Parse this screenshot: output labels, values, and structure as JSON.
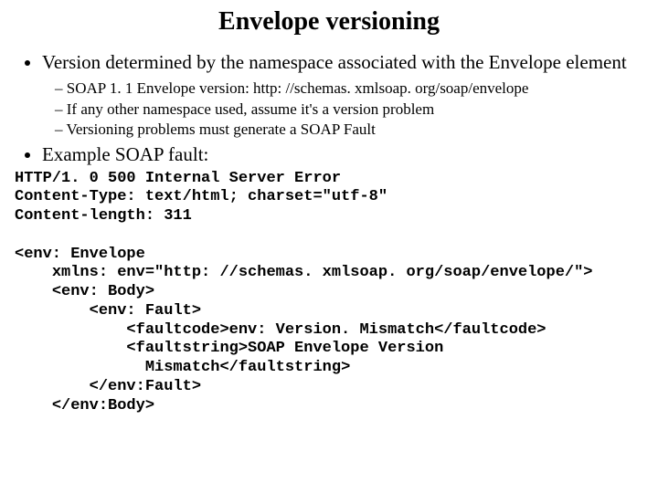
{
  "title": "Envelope versioning",
  "bullet1": "Version determined by the namespace associated with the Envelope element",
  "sub1": "SOAP 1. 1 Envelope  version: http: //schemas. xmlsoap. org/soap/envelope",
  "sub2": "If any other namespace used, assume it's a version problem",
  "sub3": "Versioning problems must generate a SOAP Fault",
  "bullet2": "Example SOAP fault:",
  "code": "HTTP/1. 0 500 Internal Server Error\nContent-Type: text/html; charset=\"utf-8\"\nContent-length: 311\n\n<env: Envelope\n    xmlns: env=\"http: //schemas. xmlsoap. org/soap/envelope/\">\n    <env: Body>\n        <env: Fault>\n            <faultcode>env: Version. Mismatch</faultcode>\n            <faultstring>SOAP Envelope Version\n              Mismatch</faultstring>\n        </env:Fault>\n    </env:Body>"
}
